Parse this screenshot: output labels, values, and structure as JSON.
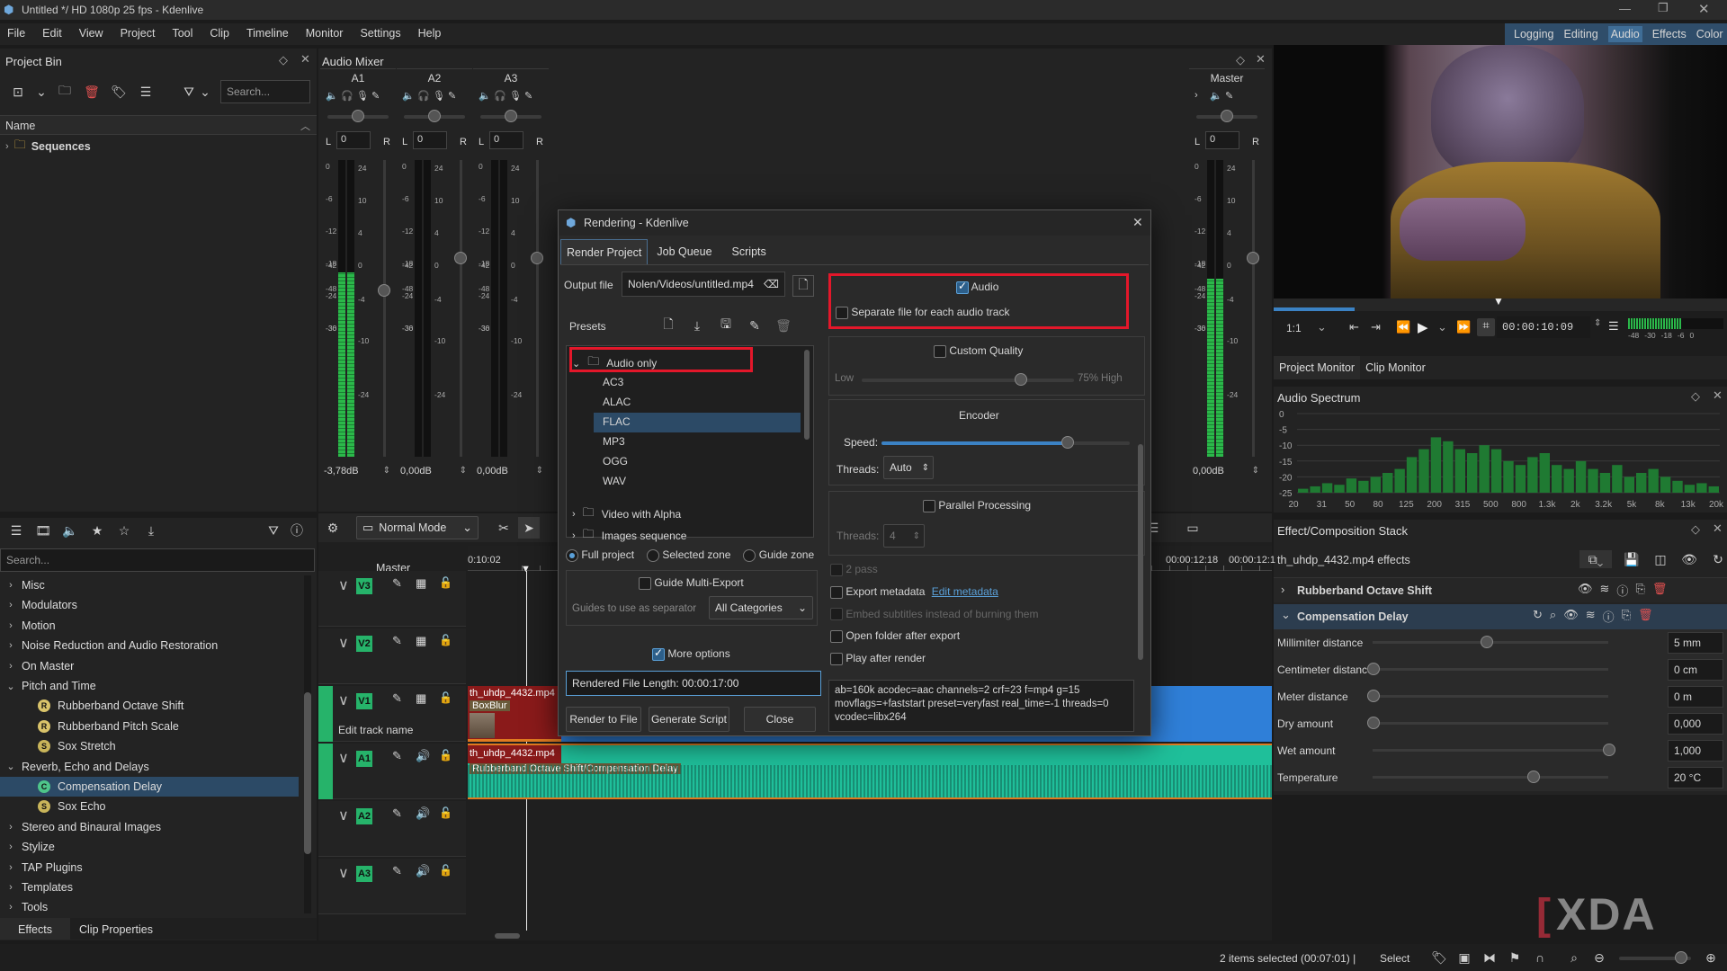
{
  "window": {
    "title": "Untitled */ HD 1080p 25 fps - Kdenlive"
  },
  "menu": [
    "File",
    "Edit",
    "View",
    "Project",
    "Tool",
    "Clip",
    "Timeline",
    "Monitor",
    "Settings",
    "Help"
  ],
  "workspaces": [
    "Logging",
    "Editing",
    "Audio",
    "Effects",
    "Color"
  ],
  "project_bin": {
    "title": "Project Bin",
    "search_placeholder": "Search...",
    "column": "Name",
    "items": [
      "Sequences"
    ]
  },
  "audio_mixer": {
    "title": "Audio Mixer",
    "channels": [
      {
        "name": "A1",
        "gain": "0",
        "db": "-3,78dB",
        "level": 0.62
      },
      {
        "name": "A2",
        "gain": "0",
        "db": "0,00dB",
        "level": 0.0
      },
      {
        "name": "A3",
        "gain": "0",
        "db": "0,00dB",
        "level": 0.0
      }
    ],
    "master": {
      "name": "Master",
      "gain": "0",
      "db": "0,00dB",
      "level": 0.6
    },
    "scale_left": [
      "0",
      "-6",
      "-12",
      "-18",
      "-24",
      "-30",
      "-36",
      "-42",
      "-48"
    ],
    "scale_right": [
      "24",
      "10",
      "4",
      "0",
      "-4",
      "-10",
      "-24"
    ],
    "lr": [
      "L",
      "R"
    ]
  },
  "effects_panel": {
    "search_placeholder": "Search...",
    "groups": [
      "Misc",
      "Modulators",
      "Motion",
      "Noise Reduction and Audio Restoration",
      "On Master",
      "Pitch and Time",
      "Reverb, Echo and Delays",
      "Stereo and Binaural Images",
      "Stylize",
      "TAP Plugins",
      "Templates",
      "Tools"
    ],
    "pitch_items": [
      {
        "badge": "R",
        "label": "Rubberband Octave Shift"
      },
      {
        "badge": "R",
        "label": "Rubberband Pitch Scale"
      },
      {
        "badge": "S",
        "label": "Sox Stretch"
      }
    ],
    "reverb_items": [
      {
        "badge": "C",
        "label": "Compensation Delay"
      },
      {
        "badge": "S",
        "label": "Sox Echo"
      }
    ],
    "tabs": [
      "Effects",
      "Clip Properties"
    ]
  },
  "timeline": {
    "mode": "Normal Mode",
    "master": "Master",
    "time_left": "0:10:02",
    "time_right1": "00:00:12:18",
    "time_right2": "00:00:12:1",
    "tracks": [
      "V3",
      "V2",
      "V1",
      "A1",
      "A2",
      "A3"
    ],
    "edit_track_name": "Edit track name",
    "v1_clip": "th_uhdp_4432.mp4",
    "v1_effect": "BoxBlur",
    "a1_clip": "th_uhdp_4432.mp4",
    "a1_effect": "Rubberband Octave Shift/Compensation Delay"
  },
  "dialog": {
    "title": "Rendering - Kdenlive",
    "tabs": [
      "Render Project",
      "Job Queue",
      "Scripts"
    ],
    "output_label": "Output file",
    "output_value": "Nolen/Videos/untitled.mp4",
    "presets_label": "Presets",
    "preset_group": "Audio only",
    "presets": [
      "AC3",
      "ALAC",
      "FLAC",
      "MP3",
      "OGG",
      "WAV"
    ],
    "preset_groups_more": [
      "Video with Alpha",
      "Images sequence"
    ],
    "zones": [
      "Full project",
      "Selected zone",
      "Guide zone"
    ],
    "guide_multi": "Guide Multi-Export",
    "guides_label": "Guides to use as separator",
    "guides_value": "All Categories",
    "more_options": "More options",
    "rendered_length": "Rendered File Length: 00:00:17:00",
    "buttons": [
      "Render to File",
      "Generate Script",
      "Close"
    ],
    "audio": "Audio",
    "separate": "Separate file for each audio track",
    "custom_quality": "Custom Quality",
    "low": "Low",
    "quality_pct": "75%",
    "high": "High",
    "quality_value": 0.75,
    "encoder": "Encoder",
    "speed": "Speed:",
    "speed_value": 0.75,
    "threads": "Threads:",
    "threads_value": "Auto",
    "parallel": "Parallel Processing",
    "par_threads": "Threads:",
    "par_threads_value": "4",
    "two_pass": "2 pass",
    "export_metadata": "Export metadata",
    "edit_metadata": "Edit metadata",
    "embed_subs": "Embed subtitles instead of burning them",
    "open_folder": "Open folder after export",
    "play_after": "Play after render",
    "params": "ab=160k acodec=aac channels=2 crf=23 f=mp4 g=15 movflags=+faststart preset=veryfast real_time=-1 threads=0 vcodec=libx264"
  },
  "monitor": {
    "zoom": "1:1",
    "timecode": "00:00:10:09",
    "tabs": [
      "Project Monitor",
      "Clip Monitor"
    ],
    "meter_scale": [
      "-48",
      "-30",
      "-18",
      "-6",
      "0"
    ]
  },
  "spectrum": {
    "title": "Audio Spectrum",
    "y": [
      "0",
      "-5",
      "-10",
      "-15",
      "-20",
      "-25"
    ],
    "x": [
      "20",
      "31",
      "50",
      "80",
      "125",
      "200",
      "315",
      "500",
      "800",
      "1.3k",
      "2k",
      "3.2k",
      "5k",
      "8k",
      "13k",
      "20k"
    ],
    "bars": [
      0.05,
      0.08,
      0.12,
      0.1,
      0.18,
      0.15,
      0.2,
      0.25,
      0.3,
      0.45,
      0.55,
      0.7,
      0.65,
      0.55,
      0.5,
      0.6,
      0.55,
      0.4,
      0.35,
      0.45,
      0.5,
      0.35,
      0.3,
      0.4,
      0.3,
      0.25,
      0.35,
      0.2,
      0.25,
      0.3,
      0.2,
      0.15,
      0.1,
      0.12,
      0.08
    ]
  },
  "effect_stack": {
    "title": "Effect/Composition Stack",
    "clip": "th_uhdp_4432.mp4 effects",
    "effects": [
      "Rubberband Octave Shift",
      "Compensation Delay"
    ],
    "params": [
      {
        "label": "Millimiter distance",
        "value": "5 mm",
        "pos": 0.48
      },
      {
        "label": "Centimeter distance",
        "value": "0 cm",
        "pos": 0.0
      },
      {
        "label": "Meter distance",
        "value": "0 m",
        "pos": 0.0
      },
      {
        "label": "Dry amount",
        "value": "0,000",
        "pos": 0.0
      },
      {
        "label": "Wet amount",
        "value": "1,000",
        "pos": 1.0
      },
      {
        "label": "Temperature",
        "value": "20 °C",
        "pos": 0.68
      }
    ]
  },
  "status": {
    "selection": "2 items selected (00:07:01) |",
    "mode": "Select"
  },
  "watermark": "XDA"
}
